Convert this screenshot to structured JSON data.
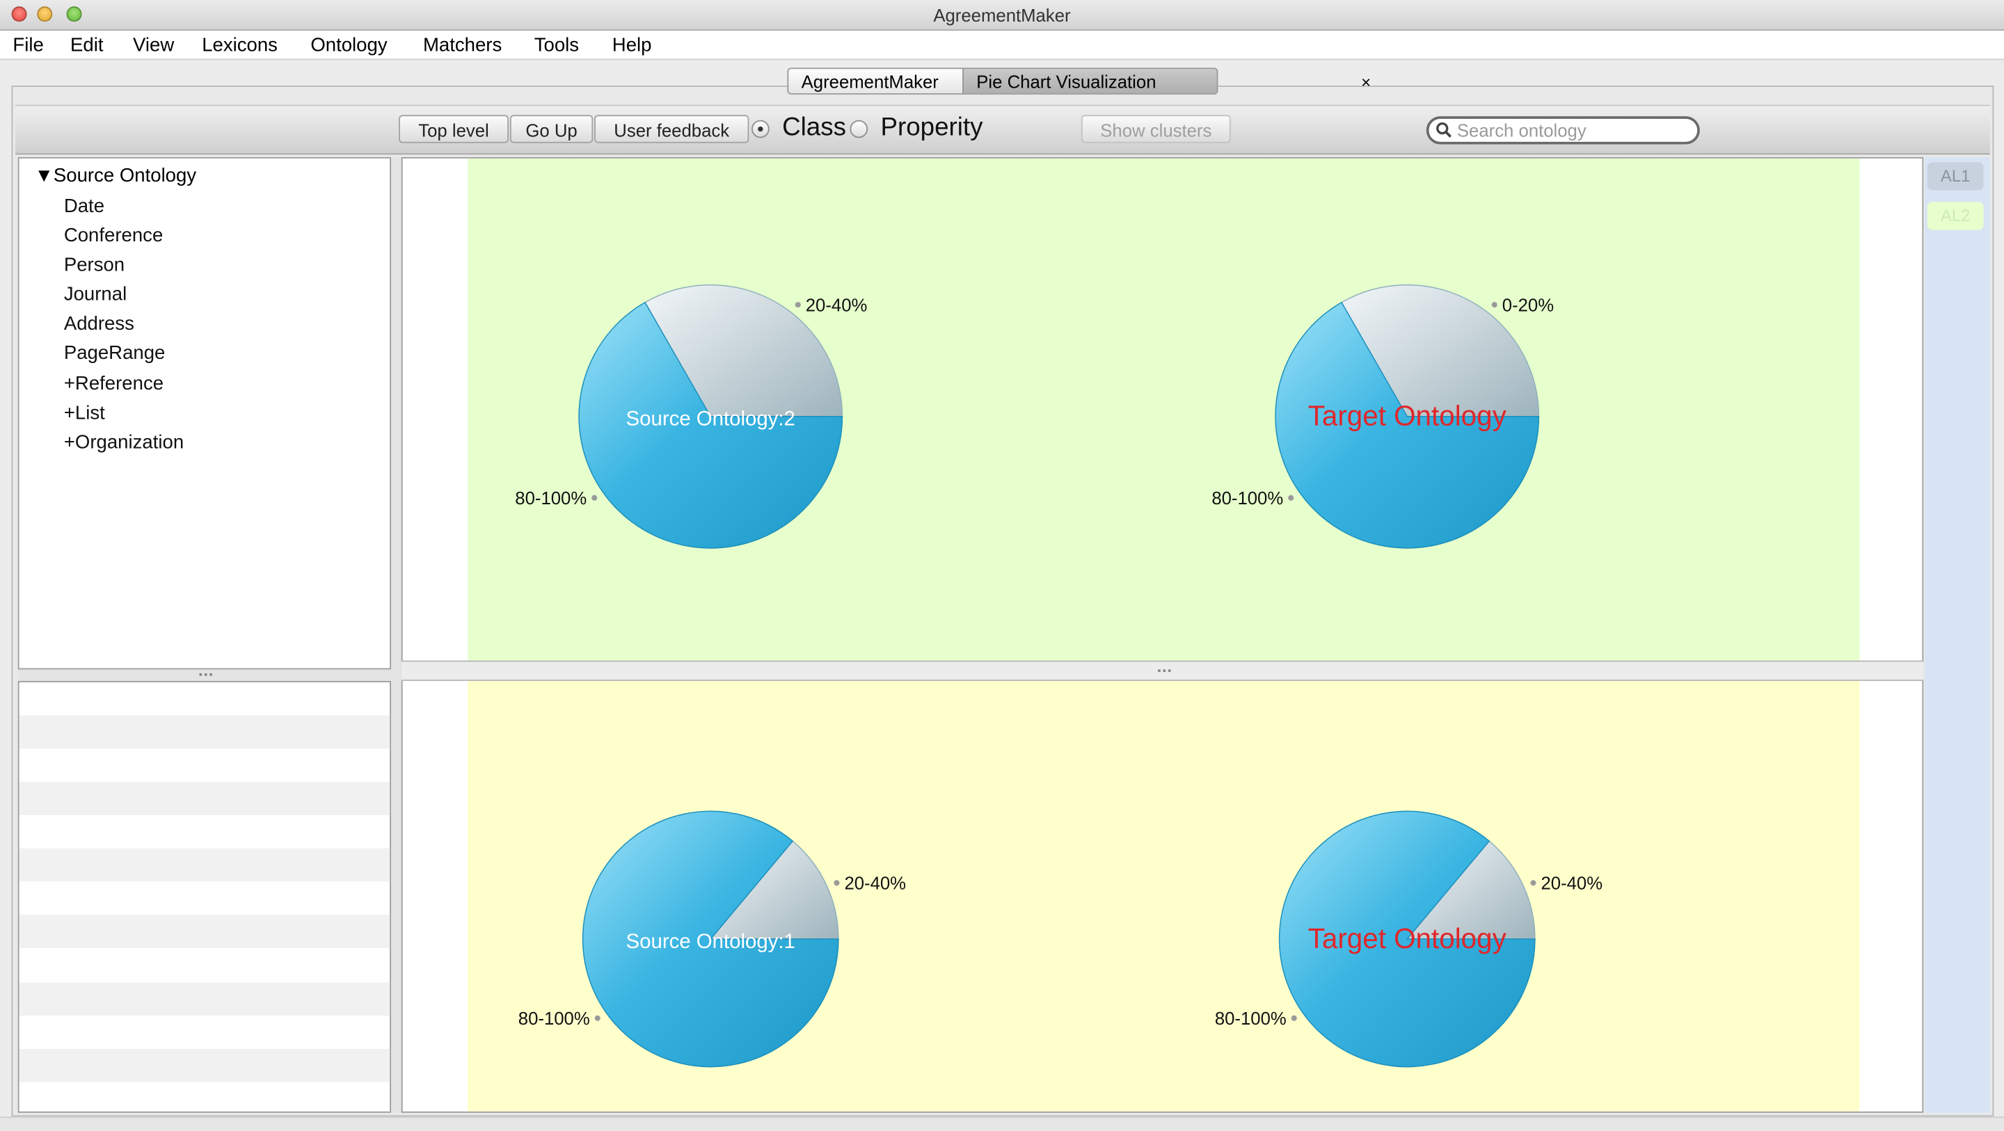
{
  "window": {
    "title": "AgreementMaker"
  },
  "menu": [
    "File",
    "Edit",
    "View",
    "Lexicons",
    "Ontology",
    "Matchers",
    "Tools",
    "Help"
  ],
  "tabs": [
    {
      "label": "AgreementMaker"
    },
    {
      "label": "Pie Chart Visualization",
      "close": "×"
    }
  ],
  "toolbar": {
    "top_level": "Top level",
    "go_up": "Go Up",
    "user_feedback": "User feedback",
    "class_label": "Class",
    "property_label": "Properity",
    "selected": "Class",
    "show_clusters": "Show clusters",
    "search_placeholder": "Search ontology",
    "search_value": ""
  },
  "tree": {
    "root": "Source Ontology",
    "root_arrow": "▼",
    "items": [
      "Date",
      "Conference",
      "Person",
      "Journal",
      "Address",
      "PageRange",
      "+Reference",
      "+List",
      "+Organization"
    ]
  },
  "side": {
    "al1": "AL1",
    "al2": "AL2"
  },
  "colors": {
    "top_panel_bg": "#e6ffcc",
    "bottom_panel_bg": "#ffffcc",
    "pie_blue": "#2aa6d6",
    "pie_gray": "#cfdde3",
    "target_label": "#e0262a"
  },
  "charts": [
    {
      "panel": "top",
      "pies": [
        {
          "center_label": "Source Ontology:2",
          "label_color": "#ffffff",
          "chart_data": {
            "type": "pie",
            "slices": [
              {
                "label": "20-40%",
                "fraction": 0.333
              },
              {
                "label": "80-100%",
                "fraction": 0.667
              }
            ]
          }
        },
        {
          "center_label": "Target Ontology",
          "label_color": "#e0262a",
          "chart_data": {
            "type": "pie",
            "slices": [
              {
                "label": "0-20%",
                "fraction": 0.333
              },
              {
                "label": "80-100%",
                "fraction": 0.667
              }
            ]
          }
        }
      ]
    },
    {
      "panel": "bottom",
      "pies": [
        {
          "center_label": "Source Ontology:1",
          "label_color": "#ffffff",
          "chart_data": {
            "type": "pie",
            "slices": [
              {
                "label": "20-40%",
                "fraction": 0.139
              },
              {
                "label": "80-100%",
                "fraction": 0.861
              }
            ]
          }
        },
        {
          "center_label": "Target Ontology",
          "label_color": "#e0262a",
          "chart_data": {
            "type": "pie",
            "slices": [
              {
                "label": "20-40%",
                "fraction": 0.139
              },
              {
                "label": "80-100%",
                "fraction": 0.861
              }
            ]
          }
        }
      ]
    }
  ]
}
